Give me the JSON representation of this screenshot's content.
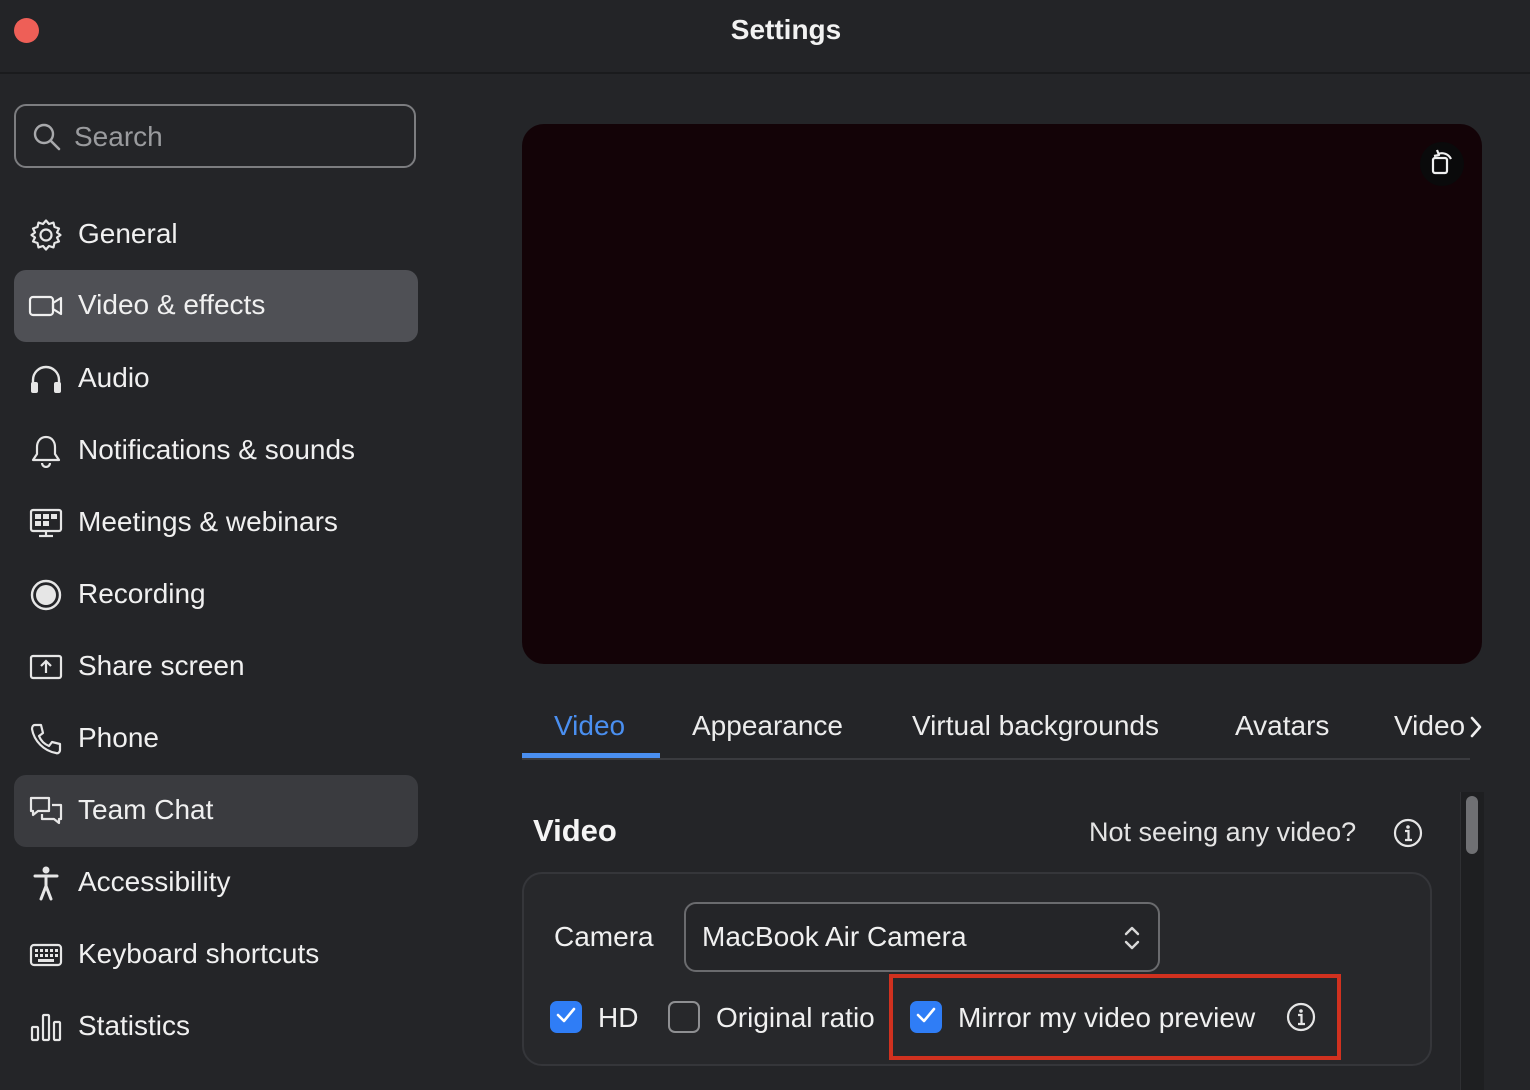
{
  "window": {
    "title": "Settings"
  },
  "search": {
    "placeholder": "Search"
  },
  "sidebar": {
    "items": [
      {
        "label": "General",
        "icon": "gear-icon",
        "state": "normal"
      },
      {
        "label": "Video & effects",
        "icon": "video-camera-icon",
        "state": "active"
      },
      {
        "label": "Audio",
        "icon": "headphones-icon",
        "state": "normal"
      },
      {
        "label": "Notifications & sounds",
        "icon": "bell-icon",
        "state": "normal"
      },
      {
        "label": "Meetings & webinars",
        "icon": "monitor-grid-icon",
        "state": "normal"
      },
      {
        "label": "Recording",
        "icon": "record-icon",
        "state": "normal"
      },
      {
        "label": "Share screen",
        "icon": "share-screen-icon",
        "state": "normal"
      },
      {
        "label": "Phone",
        "icon": "phone-icon",
        "state": "normal"
      },
      {
        "label": "Team Chat",
        "icon": "chat-bubbles-icon",
        "state": "hover"
      },
      {
        "label": "Accessibility",
        "icon": "accessibility-icon",
        "state": "normal"
      },
      {
        "label": "Keyboard shortcuts",
        "icon": "keyboard-icon",
        "state": "normal"
      },
      {
        "label": "Statistics",
        "icon": "bar-chart-icon",
        "state": "normal"
      }
    ]
  },
  "tabs": [
    {
      "label": "Video",
      "active": true
    },
    {
      "label": "Appearance",
      "active": false
    },
    {
      "label": "Virtual backgrounds",
      "active": false
    },
    {
      "label": "Avatars",
      "active": false
    },
    {
      "label": "Video",
      "active": false
    }
  ],
  "video_section": {
    "title": "Video",
    "help_text": "Not seeing any video?",
    "camera_label": "Camera",
    "camera_value": "MacBook Air Camera",
    "options": [
      {
        "label": "HD",
        "checked": true
      },
      {
        "label": "Original ratio",
        "checked": false
      },
      {
        "label": "Mirror my video preview",
        "checked": true
      }
    ]
  },
  "colors": {
    "accent": "#2f7df6",
    "tab_active": "#4a8ff0",
    "highlight": "#d0311f",
    "close_button": "#ee5f57"
  }
}
